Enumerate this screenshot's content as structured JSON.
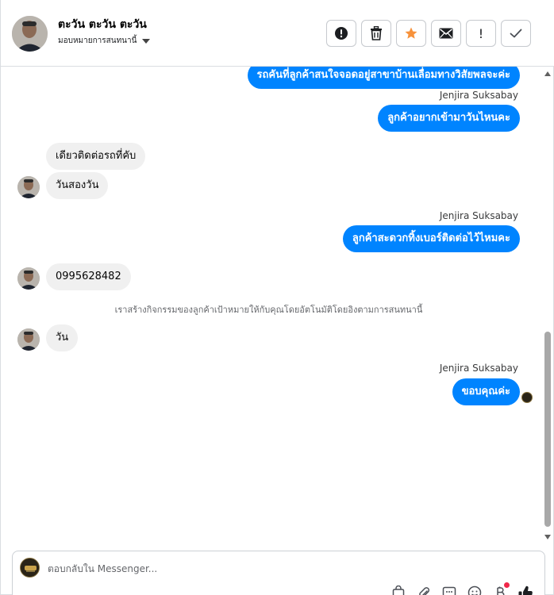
{
  "header": {
    "contact_name": "ตะวัน ตะวัน ตะวัน",
    "assign_label": "มอบหมายการสนทนานี้",
    "actions": [
      {
        "icon": "alert-circle-icon",
        "name": "spam-button"
      },
      {
        "icon": "trash-icon",
        "name": "delete-button"
      },
      {
        "icon": "star-icon",
        "name": "star-button",
        "color": "#f7923b"
      },
      {
        "icon": "envelope-icon",
        "name": "mark-unread-button"
      },
      {
        "icon": "exclamation-icon",
        "name": "follow-up-button",
        "text": "!"
      },
      {
        "icon": "checkmark-icon",
        "name": "mark-done-button"
      }
    ]
  },
  "thread": {
    "messages": [
      {
        "id": "m1",
        "direction": "out",
        "text": "รถคันที่ลูกค้าสนใจจอดอยู่สาขาบ้านเลื่อมทางวิสัยพลจะค่ะ"
      },
      {
        "id": "m2",
        "direction": "out",
        "sender": "Jenjira Suksabay",
        "text": "ลูกค้าอยากเข้ามาวันไหนคะ"
      },
      {
        "id": "m3",
        "direction": "in",
        "text": "เดียวติดต่อรถที่คับ"
      },
      {
        "id": "m4",
        "direction": "in",
        "text": "วันสองวัน"
      },
      {
        "id": "m5",
        "direction": "out",
        "sender": "Jenjira Suksabay",
        "text": "ลูกค้าสะดวกทิ้งเบอร์ติดต่อไว้ไหมคะ"
      },
      {
        "id": "m6",
        "direction": "in",
        "text": "0995628482"
      },
      {
        "id": "m7",
        "direction": "in",
        "text": "วัน"
      },
      {
        "id": "m8",
        "direction": "out",
        "sender": "Jenjira Suksabay",
        "text": "ขอบคุณค่ะ"
      }
    ],
    "system_note": "เราสร้างกิจกรรมของลูกค้าเป้าหมายให้กับคุณโดยอัตโนมัติโดยอิงตามการสนทนานี้"
  },
  "composer": {
    "placeholder": "ตอบกลับใน Messenger...",
    "value": "",
    "tools": [
      "shopping-bag-icon",
      "paperclip-icon",
      "saved-replies-icon",
      "emoji-icon",
      "baht-icon",
      "thumbs-up-icon"
    ]
  },
  "colors": {
    "accent": "#0084ff",
    "incoming_bubble": "#f0f0f0",
    "star": "#f7923b",
    "notification_dot": "#f02849"
  }
}
